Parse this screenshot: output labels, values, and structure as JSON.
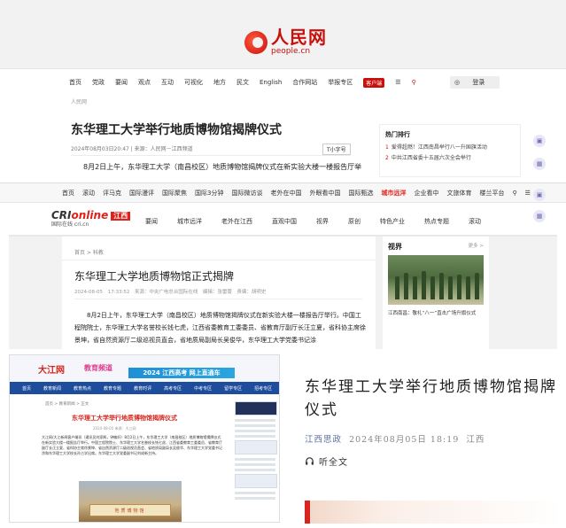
{
  "panel1": {
    "logo_cn": "人民网",
    "logo_en": "people.cn",
    "nav": [
      "首页",
      "党政",
      "要闻",
      "观点",
      "互动",
      "可视化",
      "地方",
      "民文",
      "English",
      "合作网站",
      "举报专区"
    ],
    "nav_badge": "客户端",
    "login": "登录",
    "crumb": "人民网",
    "title": "东华理工大学举行地质博物馆揭牌仪式",
    "meta": "2024年08月03日20:47 | 来源：人民网－江西频道",
    "font_btn": "小字号",
    "body": "8月2日上午，东华理工大学（南昌校区）地质博物馆揭牌仪式在新实验大楼一楼报告厅举",
    "side_head": "热门排行",
    "side_items": [
      {
        "num": "1",
        "text": "爱得超燃！江西南昌举行八一升国旗活动"
      },
      {
        "num": "2",
        "text": "中共江西省委十五届六次全会举行"
      }
    ]
  },
  "panel2": {
    "topnav": [
      "首页",
      "滚动",
      "评马克",
      "国际漫评",
      "国际聚焦",
      "国际3分钟",
      "国际微访谈",
      "老外在中国",
      "外眼看中国",
      "国际甄选",
      "城市远洋",
      "企业看中",
      "文旅体育",
      "楼兰平台"
    ],
    "logo_a1": "CRI",
    "logo_a2": "online",
    "logo_jx": "江西",
    "logo_b": "国际在线 cri.cn",
    "nav": [
      "要闻",
      "城市远洋",
      "老外在江西",
      "直观中国",
      "视界",
      "原创",
      "特色产业",
      "热点专题",
      "滚动"
    ],
    "crumb": "首页 > 科教",
    "title": "东华理工大学地质博物馆正式揭牌",
    "meta": "2024-08-05 17:33:52　来源：中央广电总台国际在线　编辑：张雷蕾　责编：胡明史",
    "body": "8月2日上午，东华理工大学（南昌校区）地质博物馆揭牌仪式在新实验大楼一楼报告厅举行。中国工程院院士，东华理工大学名誉校长钱七虎，江西省委教育工委委员、省教育厅副厅长汪立夏，省科协主席徐景坤，省自然资源厅二级巡视员直会，省地质局副局长吴俊华，东华理工大学党委书记涂",
    "side_head": "视界",
    "side_more": "更多",
    "side_cap": "江西南昌：敬礼“八一”直击广场升旗仪式"
  },
  "panel3": {
    "logo": "大江网",
    "logo2": "教育频道",
    "banner": "2024 江西高考 网上直通车",
    "nav": [
      "首页",
      "教育新闻",
      "教育热点",
      "教育专题",
      "教育时评",
      "高考专区",
      "中考专区",
      "留学专区",
      "招考专区"
    ],
    "crumb": "首页 > 教育新闻 > 正文",
    "title": "东华理工大学举行地质博物馆揭牌仪式",
    "meta": "2024-08-05 来源：大江网",
    "body": "大江网/大江新闻客户端讯（通讯员刘家辉，钟敏轩）8月2日上午，东华理工大学（南昌校区）地质博物馆揭牌仪式在新实验大楼一楼报告厅举行。中国工程院院士、东华理工大学名誉校长钱七虎、江西省委教育工委委员、省教育厅副厅长汪立夏、省科协主席徐景坤、省自然资源厅二级巡视员直会、省地质局副局长吴俊华、东华理工大学党委书记涂和东华理工大学校长孙占学出席。东华理工大学党委副书记刘成新主持。",
    "sign": "地质博物馆"
  },
  "panel4": {
    "title": "东华理工大学举行地质博物馆揭牌仪式",
    "source": "江西思政",
    "date": "2024年08月05日 18:19",
    "location": "江西",
    "listen": "听全文"
  }
}
